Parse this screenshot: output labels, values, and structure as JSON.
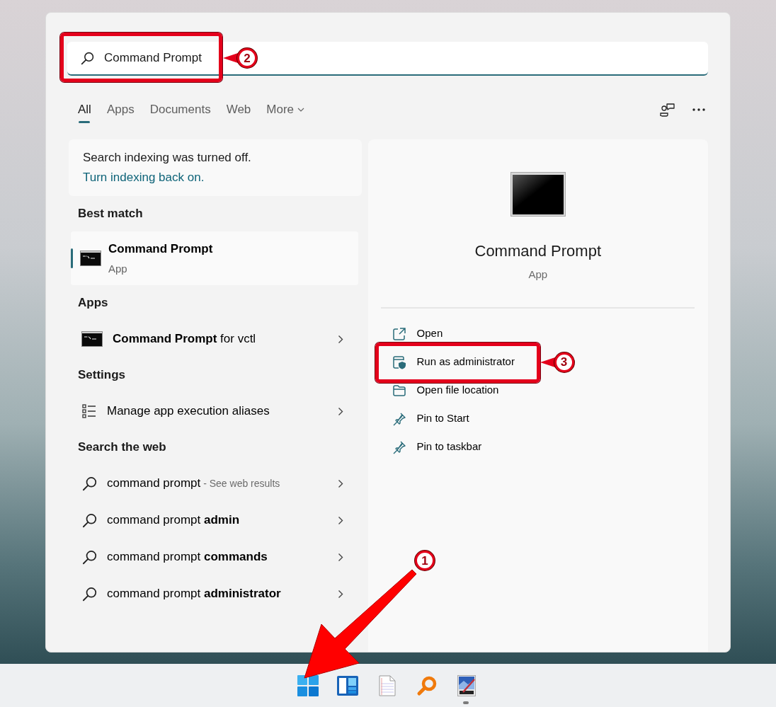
{
  "search": {
    "value": "Command Prompt",
    "highlighted": true,
    "callout": "2"
  },
  "tabs": [
    {
      "label": "All",
      "selected": true,
      "kind": "plain"
    },
    {
      "label": "Apps",
      "selected": false,
      "kind": "plain"
    },
    {
      "label": "Documents",
      "selected": false,
      "kind": "plain"
    },
    {
      "label": "Web",
      "selected": false,
      "kind": "plain"
    },
    {
      "label": "More",
      "selected": false,
      "kind": "dropdown"
    }
  ],
  "notice": {
    "text": "Search indexing was turned off.",
    "link": "Turn indexing back on."
  },
  "best_match": {
    "heading": "Best match",
    "title": "Command Prompt",
    "subtitle": "App",
    "selected": true
  },
  "sections": [
    {
      "heading": "Apps",
      "items": [
        {
          "kind": "console",
          "text": "**Command Prompt** for vctl"
        }
      ]
    },
    {
      "heading": "Settings",
      "items": [
        {
          "kind": "list",
          "text": "Manage app execution aliases"
        }
      ]
    },
    {
      "heading": "Search the web",
      "items": [
        {
          "kind": "web",
          "text": "command prompt",
          "note": "- See web results"
        },
        {
          "kind": "web",
          "text": "command prompt **admin**"
        },
        {
          "kind": "web",
          "text": "command prompt **commands**"
        },
        {
          "kind": "web",
          "text": "command prompt **administrator**"
        }
      ]
    }
  ],
  "detail": {
    "title": "Command Prompt",
    "subtitle": "App",
    "actions": [
      {
        "kind": "open",
        "label": "Open",
        "highlighted": false
      },
      {
        "kind": "shield",
        "label": "Run as administrator",
        "highlighted": true,
        "callout": "3"
      },
      {
        "kind": "folder",
        "label": "Open file location",
        "highlighted": false
      },
      {
        "kind": "pin",
        "label": "Pin to Start",
        "highlighted": false
      },
      {
        "kind": "pin",
        "label": "Pin to taskbar",
        "highlighted": false
      }
    ]
  },
  "taskbar": {
    "icons": [
      {
        "kind": "start",
        "running": false,
        "callout": "1"
      },
      {
        "kind": "widgets",
        "running": false
      },
      {
        "kind": "notepad",
        "running": false
      },
      {
        "kind": "search",
        "running": false
      },
      {
        "kind": "paint",
        "running": true
      }
    ]
  }
}
